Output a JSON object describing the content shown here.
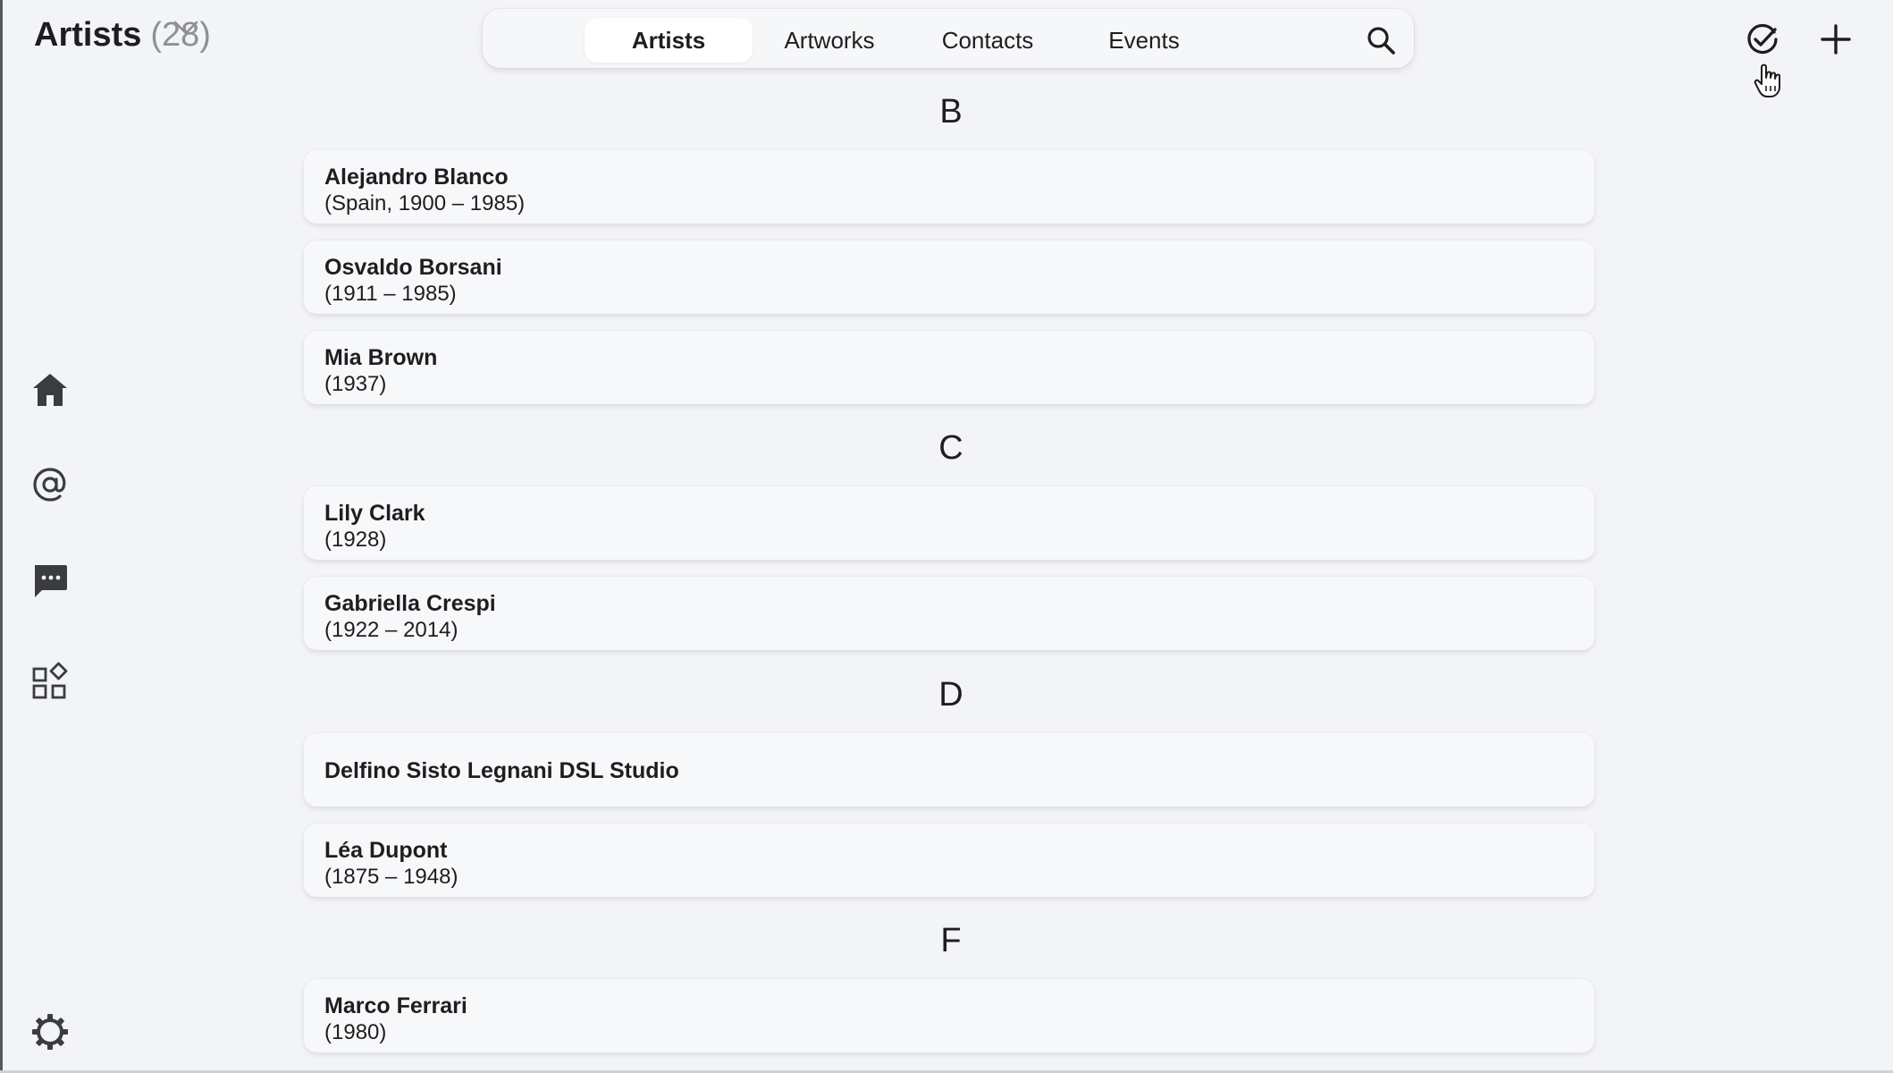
{
  "header": {
    "title": "Artists",
    "count": "(28)",
    "chevron_icon": "chevron-down-icon"
  },
  "tabs": [
    {
      "label": "Artists",
      "active": true
    },
    {
      "label": "Artworks",
      "active": false
    },
    {
      "label": "Contacts",
      "active": false
    },
    {
      "label": "Events",
      "active": false
    }
  ],
  "toolbar": {
    "search_icon": "search-icon",
    "select_icon": "check-circle-icon",
    "add_icon": "plus-icon"
  },
  "sidebar": {
    "items": [
      {
        "icon": "home-icon",
        "active": true
      },
      {
        "icon": "at-icon",
        "active": false
      },
      {
        "icon": "chat-icon",
        "active": false
      },
      {
        "icon": "apps-icon",
        "active": false
      }
    ],
    "settings_icon": "gear-icon"
  },
  "sections": [
    {
      "letter": "B",
      "artists": [
        {
          "name": "Alejandro Blanco",
          "meta": "(Spain, 1900 – 1985)"
        },
        {
          "name": "Osvaldo Borsani",
          "meta": "(1911 – 1985)"
        },
        {
          "name": "Mia Brown",
          "meta": "(1937)"
        }
      ]
    },
    {
      "letter": "C",
      "artists": [
        {
          "name": "Lily Clark",
          "meta": "(1928)"
        },
        {
          "name": "Gabriella Crespi",
          "meta": "(1922 – 2014)"
        }
      ]
    },
    {
      "letter": "D",
      "artists": [
        {
          "name": "Delfino Sisto Legnani DSL Studio",
          "meta": ""
        },
        {
          "name": "Léa Dupont",
          "meta": "(1875 – 1948)"
        }
      ]
    },
    {
      "letter": "F",
      "artists": [
        {
          "name": "Marco Ferrari",
          "meta": "(1980)"
        }
      ]
    }
  ],
  "colors": {
    "background": "#f3f4f7",
    "card": "#f7f8fa",
    "text": "#1e1e20",
    "muted": "#8e9096",
    "icon": "#3a3c40"
  }
}
